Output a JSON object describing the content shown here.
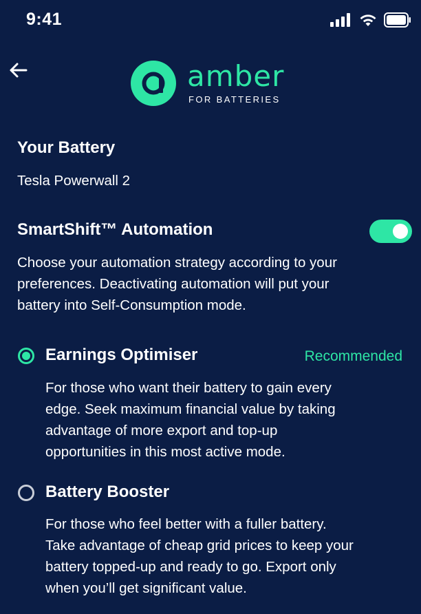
{
  "status_bar": {
    "time": "9:41",
    "icons": [
      "cellular-signal-icon",
      "wifi-icon",
      "battery-icon"
    ]
  },
  "header": {
    "back_icon": "back-arrow-icon",
    "logo_word": "amber",
    "logo_subtitle": "FOR BATTERIES"
  },
  "battery": {
    "heading": "Your Battery",
    "model": "Tesla Powerwall 2"
  },
  "automation": {
    "heading": "SmartShift™ Automation",
    "enabled": true,
    "description_lines": [
      "Choose your automation strategy according to your",
      "preferences. Deactivating automation will put your",
      "battery into Self-Consumption mode."
    ]
  },
  "options": [
    {
      "title": "Earnings Optimiser",
      "selected": true,
      "badge": "Recommended",
      "description_lines": [
        "For those who want their battery to gain every",
        "edge. Seek maximum financial value by taking",
        "advantage of more export and top-up",
        "opportunities in this most active mode."
      ]
    },
    {
      "title": "Battery Booster",
      "selected": false,
      "description_lines": [
        "For those who feel better with a fuller battery.",
        "Take advantage of cheap grid prices to keep your",
        "battery topped-up and ready to go. Export only",
        "when you’ll get significant value."
      ]
    }
  ],
  "colors": {
    "background": "#0b1d45",
    "accent": "#2ee6a5",
    "text": "#ffffff"
  }
}
